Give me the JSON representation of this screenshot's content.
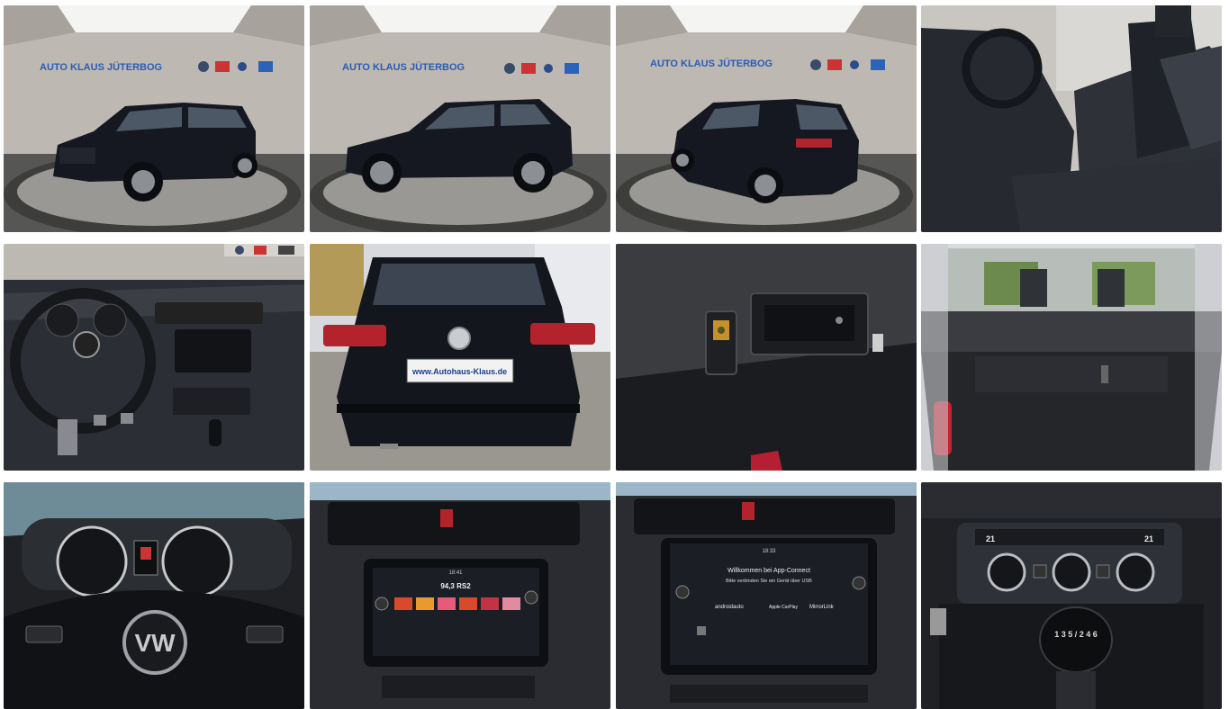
{
  "gallery": {
    "showroom_brand": "AUTO KLAUS JÜTERBOG",
    "showroom_brand_prefix": "AUTO",
    "showroom_brand_suffix": "KLAUS JÜTERBOG",
    "plate_text": "www.Autohaus-Klaus.de",
    "radio_freq": "94,3 RS2",
    "radio_time": "18:41",
    "app_time": "18:33",
    "app_connect_line1": "Willkommen bei App-Connect",
    "app_connect_line2": "Bitte verbinden Sie ein Gerät über USB",
    "android_auto": "androidauto",
    "apple_carplay": "Apple CarPlay",
    "mirrorlink": "MirrorLink",
    "climate_left": "21",
    "climate_right": "21",
    "gear_pattern": "1 3 5 / 2 4 6",
    "colors": {
      "car_body": "#15171f",
      "showroom_wall": "#b9b6b0",
      "floor": "#5a5a58",
      "turntable": "#9c9a96",
      "interior": "#2a2d33",
      "screen_bg": "#1c1e26"
    }
  }
}
